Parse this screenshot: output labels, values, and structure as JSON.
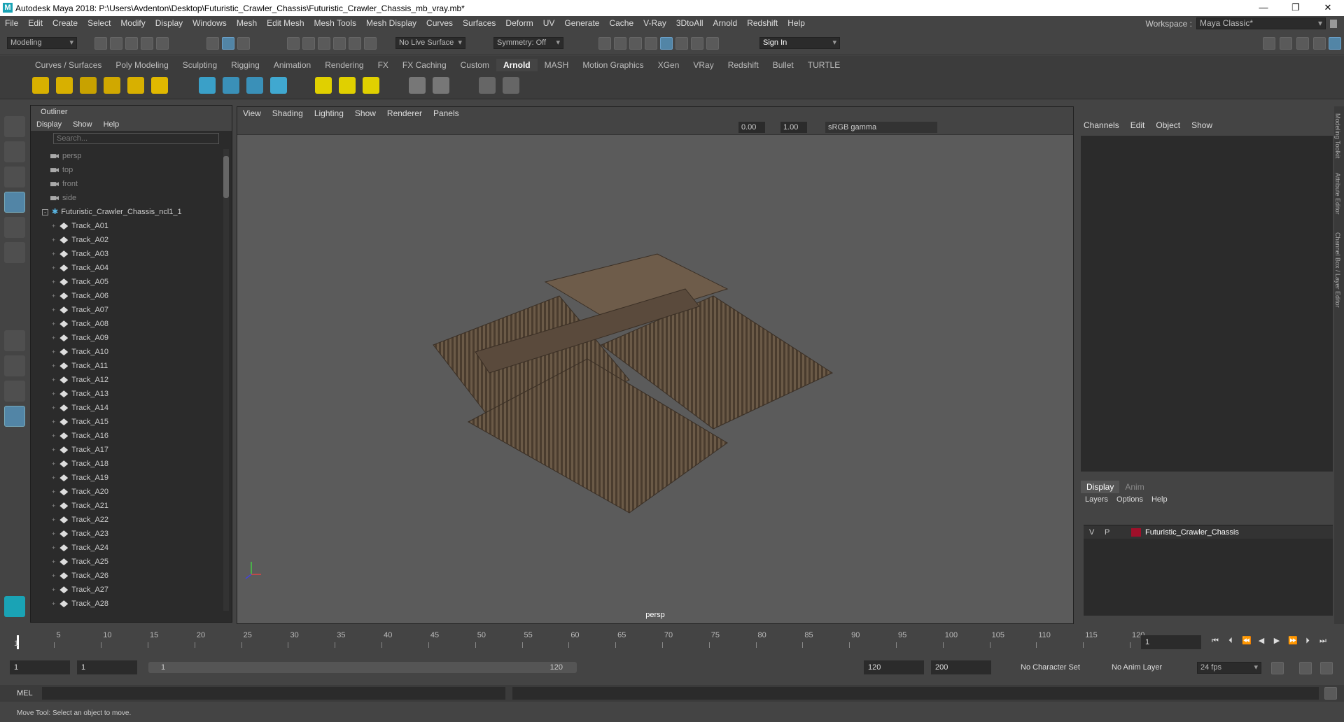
{
  "window": {
    "title": "Autodesk Maya 2018: P:\\Users\\Avdenton\\Desktop\\Futuristic_Crawler_Chassis\\Futuristic_Crawler_Chassis_mb_vray.mb*",
    "controls": [
      "—",
      "❐",
      "✕"
    ]
  },
  "menubar": [
    "File",
    "Edit",
    "Create",
    "Select",
    "Modify",
    "Display",
    "Windows",
    "Mesh",
    "Edit Mesh",
    "Mesh Tools",
    "Mesh Display",
    "Curves",
    "Surfaces",
    "Deform",
    "UV",
    "Generate",
    "Cache",
    "V-Ray",
    "3DtoAll",
    "Arnold",
    "Redshift",
    "Help"
  ],
  "workspace": {
    "label": "Workspace :",
    "value": "Maya Classic*"
  },
  "status": {
    "mode": "Modeling",
    "live_surface": "No Live Surface",
    "symmetry": "Symmetry: Off",
    "sign_in": "Sign In"
  },
  "shelf_tabs": [
    "Curves / Surfaces",
    "Poly Modeling",
    "Sculpting",
    "Rigging",
    "Animation",
    "Rendering",
    "FX",
    "FX Caching",
    "Custom",
    "Arnold",
    "MASH",
    "Motion Graphics",
    "XGen",
    "VRay",
    "Redshift",
    "Bullet",
    "TURTLE"
  ],
  "shelf_active": "Arnold",
  "outliner": {
    "title": "Outliner",
    "menu": [
      "Display",
      "Show",
      "Help"
    ],
    "search_placeholder": "Search...",
    "cameras": [
      "persp",
      "top",
      "front",
      "side"
    ],
    "group": "Futuristic_Crawler_Chassis_ncl1_1",
    "items": [
      "Track_A01",
      "Track_A02",
      "Track_A03",
      "Track_A04",
      "Track_A05",
      "Track_A06",
      "Track_A07",
      "Track_A08",
      "Track_A09",
      "Track_A10",
      "Track_A11",
      "Track_A12",
      "Track_A13",
      "Track_A14",
      "Track_A15",
      "Track_A16",
      "Track_A17",
      "Track_A18",
      "Track_A19",
      "Track_A20",
      "Track_A21",
      "Track_A22",
      "Track_A23",
      "Track_A24",
      "Track_A25",
      "Track_A26",
      "Track_A27",
      "Track_A28"
    ]
  },
  "viewport": {
    "menu": [
      "View",
      "Shading",
      "Lighting",
      "Show",
      "Renderer",
      "Panels"
    ],
    "exposure": "0.00",
    "gamma": "1.00",
    "colorspace": "sRGB gamma",
    "camera_label": "persp"
  },
  "channel_box": {
    "menu": [
      "Channels",
      "Edit",
      "Object",
      "Show"
    ]
  },
  "layer_editor": {
    "tabs": [
      "Display",
      "Anim"
    ],
    "menu": [
      "Layers",
      "Options",
      "Help"
    ],
    "layer": {
      "v": "V",
      "p": "P",
      "name": "Futuristic_Crawler_Chassis",
      "color": "#a0102a"
    }
  },
  "side_tabs": [
    "Modeling Toolkit",
    "Attribute Editor",
    "Channel Box / Layer Editor"
  ],
  "timeline": {
    "ticks": [
      "1",
      "5",
      "10",
      "15",
      "20",
      "25",
      "30",
      "35",
      "40",
      "45",
      "50",
      "55",
      "60",
      "65",
      "70",
      "75",
      "80",
      "85",
      "90",
      "95",
      "100",
      "105",
      "110",
      "115",
      "120"
    ],
    "current_frame": "1"
  },
  "range": {
    "start": "1",
    "anim_start": "1",
    "slider_start": "1",
    "slider_end": "120",
    "end": "120",
    "anim_end": "200",
    "char_set": "No Character Set",
    "anim_layer": "No Anim Layer",
    "fps": "24 fps"
  },
  "cmdline": {
    "label": "MEL"
  },
  "helpline": "Move Tool: Select an object to move.",
  "accent": "#5285a6"
}
